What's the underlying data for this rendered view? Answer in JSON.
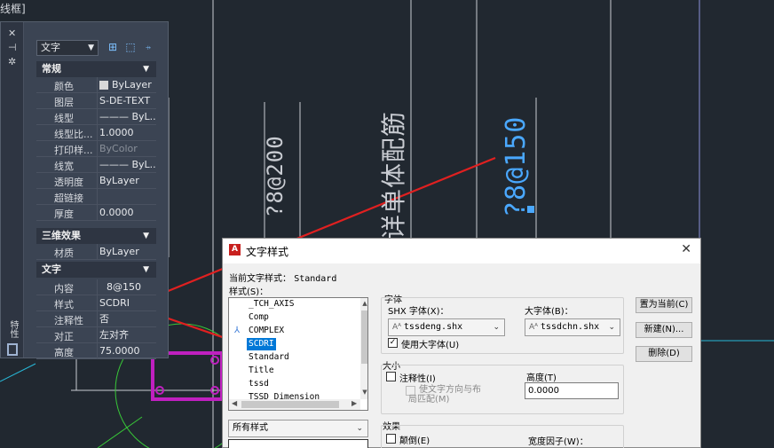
{
  "window": {
    "title_fragment": "线框]"
  },
  "drawing": {
    "texts": [
      "?8@200",
      "详单体配筋",
      "?8@150"
    ],
    "colors": {
      "bg": "#212830",
      "lines": "#c9ccd2",
      "selected": "#4aa8ff",
      "magenta": "#c020c0",
      "green": "#38c838",
      "arrow": "#e02020",
      "cyan": "#28b8d8"
    }
  },
  "props": {
    "side_icons": [
      "close-icon",
      "pin-icon",
      "settings-icon"
    ],
    "side_label": "特性",
    "object_type": "文字",
    "toolbar_icons": [
      "toggle-pickadd-icon",
      "select-objects-icon",
      "quick-select-icon"
    ],
    "sections": {
      "general": "常规",
      "three_d": "三维效果",
      "text": "文字"
    },
    "general_rows": [
      {
        "label": "颜色",
        "value": "ByLayer"
      },
      {
        "label": "图层",
        "value": "S-DE-TEXT"
      },
      {
        "label": "线型",
        "value": "——— ByL..."
      },
      {
        "label": "线型比...",
        "value": "1.0000"
      },
      {
        "label": "打印样...",
        "value": "ByColor"
      },
      {
        "label": "线宽",
        "value": "——— ByL..."
      },
      {
        "label": "透明度",
        "value": "ByLayer"
      },
      {
        "label": "超链接",
        "value": ""
      },
      {
        "label": "厚度",
        "value": "0.0000"
      }
    ],
    "three_d_rows": [
      {
        "label": "材质",
        "value": "ByLayer"
      }
    ],
    "text_rows": [
      {
        "label": "内容",
        "value": "8@150"
      },
      {
        "label": "样式",
        "value": "SCDRI"
      },
      {
        "label": "注释性",
        "value": "否"
      },
      {
        "label": "对正",
        "value": "左对齐"
      },
      {
        "label": "高度",
        "value": "75.0000"
      }
    ]
  },
  "dialog": {
    "title": "文字样式",
    "current_style_label": "当前文字样式：",
    "current_style_value": "Standard",
    "styles_label": "样式(S)：",
    "styles": [
      "_TCH_AXIS",
      "Comp",
      "COMPLEX",
      "SCDRI",
      "Standard",
      "Title",
      "tssd",
      "TSSD_Dimension"
    ],
    "selected_style": "SCDRI",
    "filter": "所有样式",
    "font_group": "字体",
    "shx_label": "SHX 字体(X)：",
    "shx_value": "tssdeng.shx",
    "big_font_label": "大字体(B)：",
    "big_font_value": "tssdchn.shx",
    "use_big_font": "使用大字体(U)",
    "size_group": "大小",
    "annotative": "注释性(I)",
    "match_orientation": "使文字方向与布局匹配(M)",
    "height_label": "高度(T)",
    "height_value": "0.0000",
    "effects_group": "效果",
    "upside_down": "颠倒(E)",
    "width_factor_label": "宽度因子(W)：",
    "buttons": {
      "set_current": "置为当前(C)",
      "new": "新建(N)...",
      "delete": "删除(D)"
    },
    "close_glyph": "✕"
  }
}
